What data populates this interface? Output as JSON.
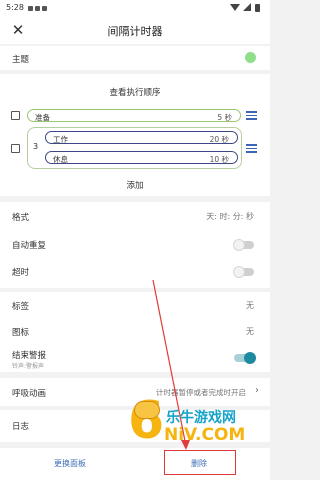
{
  "status_bar": {
    "time": "5:28"
  },
  "app_bar": {
    "title": "间隔计时器"
  },
  "theme": {
    "label": "主题",
    "color": "#8ede8a"
  },
  "sequence": {
    "title": "查看执行顺序",
    "item_prepare": {
      "label": "准备",
      "value": "5 秒"
    },
    "group": {
      "repeat_count": "3",
      "items": [
        {
          "label": "工作",
          "value": "20 秒"
        },
        {
          "label": "休息",
          "value": "10 秒"
        }
      ]
    },
    "add_label": "添加"
  },
  "settings": {
    "format": {
      "label": "格式",
      "value": "天: 时: 分: 秒"
    },
    "auto_repeat": {
      "label": "自动重复",
      "enabled": false
    },
    "overtime": {
      "label": "超时",
      "enabled": false
    },
    "tag": {
      "label": "标签",
      "value": "无"
    },
    "icon": {
      "label": "图标",
      "value": "无"
    },
    "end_alert": {
      "label": "结束警报",
      "sub": "铃声:警报声",
      "enabled": true
    },
    "breath_anim": {
      "label": "呼吸动画",
      "value": "计时器暂停或者完成时开启"
    },
    "log": {
      "label": "日志"
    }
  },
  "bottom_bar": {
    "change_panel": "更换面板",
    "delete": "删除"
  },
  "watermark": {
    "big": "6",
    "name": "乐牛游戏网",
    "domain": "NiV.COM"
  },
  "colors": {
    "accent": "#1d8aa0",
    "link": "#3e6db5",
    "annotation": "#e23b3b",
    "pill_green": "#9ac772",
    "pill_navy": "#3d4785"
  }
}
